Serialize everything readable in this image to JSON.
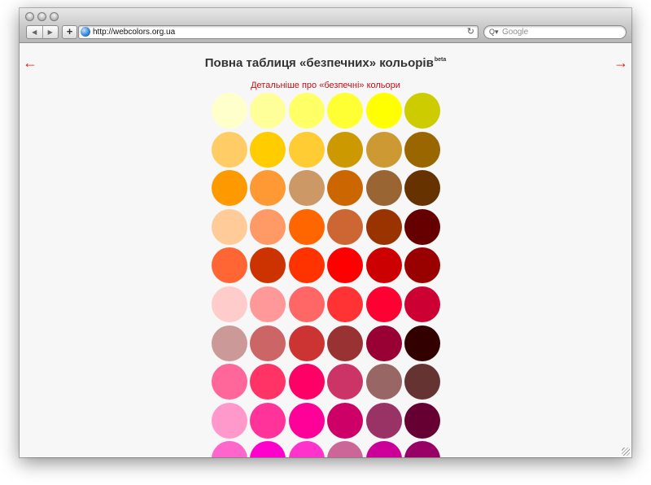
{
  "browser": {
    "url": "http://webcolors.org.ua",
    "search_placeholder": "Google",
    "back_icon": "back-arrow-icon",
    "forward_icon": "forward-arrow-icon",
    "add_label": "+",
    "reload_icon": "reload-icon"
  },
  "page": {
    "title": "Повна таблиця «безпечних» кольорів",
    "title_badge": "beta",
    "detail_link": "Детальніше про «безпечні» кольори",
    "prev_arrow": "←",
    "next_arrow": "→",
    "accent_color": "#e11a1a"
  },
  "swatches": [
    "#FFFFCC",
    "#FFFF99",
    "#FFFF66",
    "#FFFF33",
    "#FFFF00",
    "#CCCC00",
    "#FFCC66",
    "#FFCC00",
    "#FFCC33",
    "#CC9900",
    "#CC9933",
    "#996600",
    "#FF9900",
    "#FF9933",
    "#CC9966",
    "#CC6600",
    "#996633",
    "#663300",
    "#FFCC99",
    "#FF9966",
    "#FF6600",
    "#CC6633",
    "#993300",
    "#660000",
    "#FF6633",
    "#CC3300",
    "#FF3300",
    "#FF0000",
    "#CC0000",
    "#990000",
    "#FFCCCC",
    "#FF9999",
    "#FF6666",
    "#FF3333",
    "#FF0033",
    "#CC0033",
    "#CC9999",
    "#CC6666",
    "#CC3333",
    "#993333",
    "#990033",
    "#330000",
    "#FF6699",
    "#FF3366",
    "#FF0066",
    "#CC3366",
    "#996666",
    "#663333",
    "#FF99CC",
    "#FF3399",
    "#FF0099",
    "#CC0066",
    "#993366",
    "#660033",
    "#FF66CC",
    "#FF00CC",
    "#FF33CC",
    "#CC6699",
    "#CC0099",
    "#990066"
  ]
}
